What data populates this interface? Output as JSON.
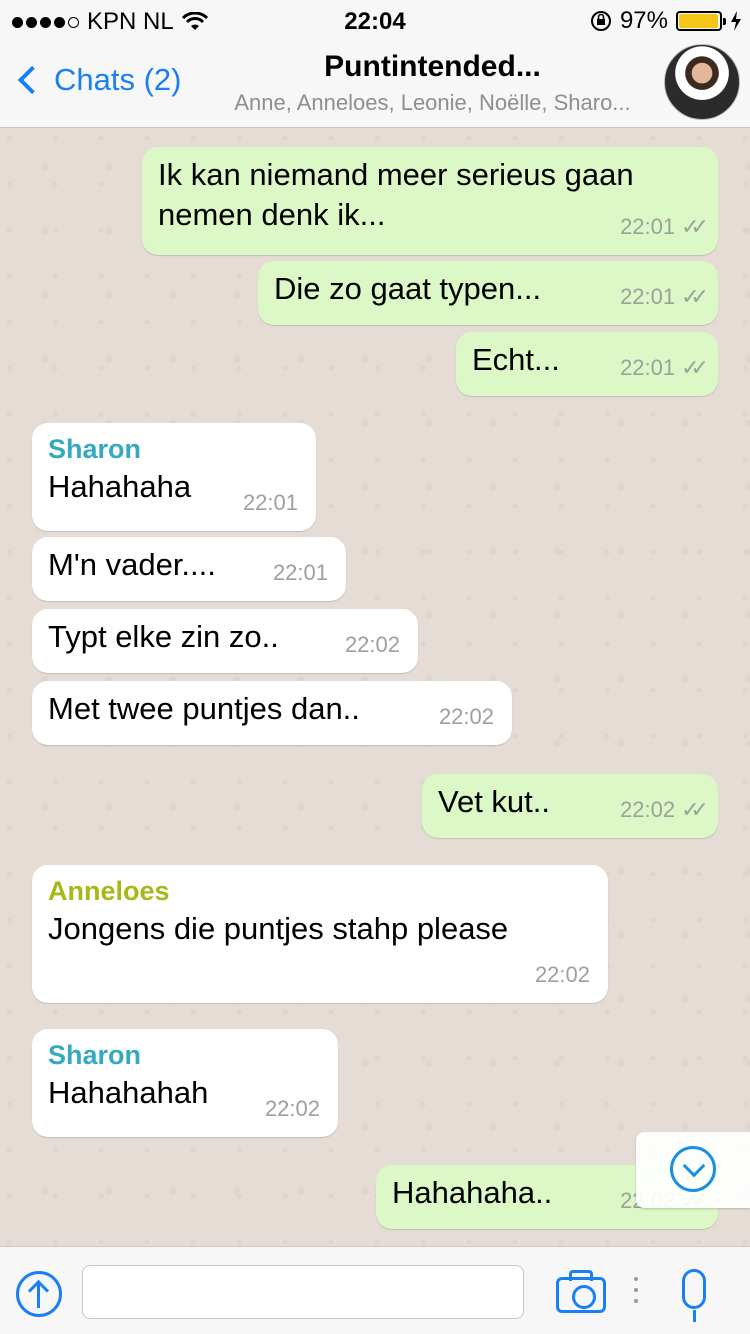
{
  "status_bar": {
    "carrier": "KPN NL",
    "time": "22:04",
    "battery_percent": "97%",
    "battery_level": 0.97,
    "signal_icon": "signal-dots-icon",
    "wifi_icon": "wifi-icon",
    "lock_icon": "rotation-lock-icon",
    "charging_icon": "charging-bolt-icon"
  },
  "nav": {
    "back_label": "Chats (2)",
    "title": "Puntintended...",
    "subtitle": "Anne, Anneloes, Leonie, Noëlle, Sharo...",
    "avatar_icon": "group-avatar-icon"
  },
  "colors": {
    "accent": "#1a7ff5",
    "outgoing_bubble": "#dcf8c6",
    "incoming_bubble": "#ffffff",
    "sender_sharon": "#35a9c0",
    "sender_anneloes": "#a8b81b",
    "chat_background": "#e5ddd5"
  },
  "messages": [
    {
      "direction": "out",
      "text": "Ik kan niemand meer serieus gaan nemen denk ik...",
      "time": "22:01",
      "ticks": "✓✓"
    },
    {
      "direction": "out",
      "text": "Die zo gaat typen...",
      "time": "22:01",
      "ticks": "✓✓"
    },
    {
      "direction": "out",
      "text": "Echt...",
      "time": "22:01",
      "ticks": "✓✓"
    },
    {
      "direction": "in",
      "sender": "Sharon",
      "text": "Hahahaha",
      "time": "22:01"
    },
    {
      "direction": "in",
      "text": "M'n vader....",
      "time": "22:01"
    },
    {
      "direction": "in",
      "text": "Typt elke zin zo..",
      "time": "22:02"
    },
    {
      "direction": "in",
      "text": "Met twee puntjes dan..",
      "time": "22:02"
    },
    {
      "direction": "out",
      "text": "Vet kut..",
      "time": "22:02",
      "ticks": "✓✓"
    },
    {
      "direction": "in",
      "sender": "Anneloes",
      "text": "Jongens die puntjes stahp please",
      "time": "22:02"
    },
    {
      "direction": "in",
      "sender": "Sharon",
      "text": "Hahahahah",
      "time": "22:02"
    },
    {
      "direction": "out",
      "text": "Hahahaha..",
      "time": "22:02",
      "ticks": "✓✓"
    }
  ],
  "input_bar": {
    "placeholder": "",
    "share_icon": "share-up-icon",
    "camera_icon": "camera-icon",
    "mic_icon": "microphone-icon"
  },
  "scroll_button_icon": "chevron-down-circle-icon"
}
